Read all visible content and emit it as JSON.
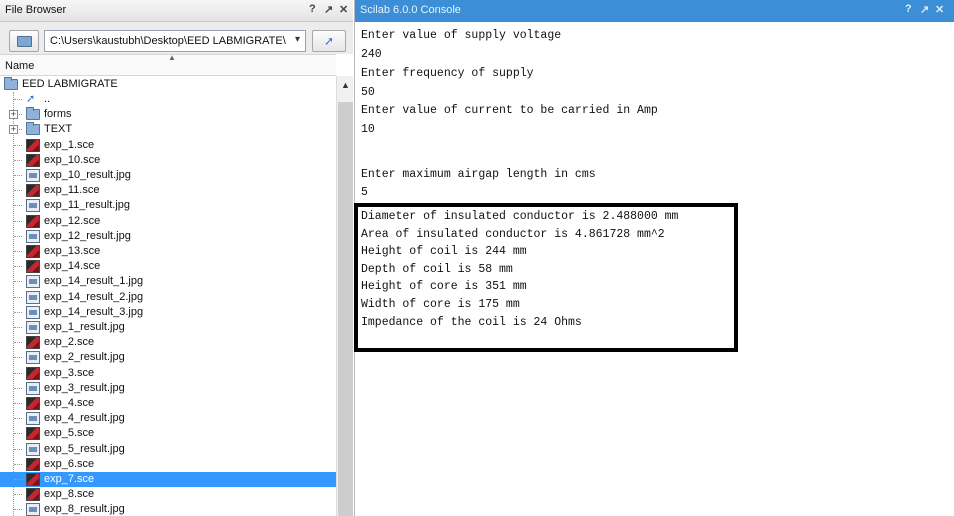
{
  "file_browser": {
    "title": "File Browser",
    "controls": [
      "?",
      "↗",
      "✕"
    ],
    "path": "C:\\Users\\kaustubh\\Desktop\\EED LABMIGRATE\\",
    "column_header": "Name",
    "root": "EED LABMIGRATE",
    "items": [
      {
        "label": "..",
        "kind": "up"
      },
      {
        "label": "forms",
        "kind": "folder"
      },
      {
        "label": "TEXT",
        "kind": "folder"
      },
      {
        "label": "exp_1.sce",
        "kind": "sce"
      },
      {
        "label": "exp_10.sce",
        "kind": "sce"
      },
      {
        "label": "exp_10_result.jpg",
        "kind": "jpg"
      },
      {
        "label": "exp_11.sce",
        "kind": "sce"
      },
      {
        "label": "exp_11_result.jpg",
        "kind": "jpg"
      },
      {
        "label": "exp_12.sce",
        "kind": "sce"
      },
      {
        "label": "exp_12_result.jpg",
        "kind": "jpg"
      },
      {
        "label": "exp_13.sce",
        "kind": "sce"
      },
      {
        "label": "exp_14.sce",
        "kind": "sce"
      },
      {
        "label": "exp_14_result_1.jpg",
        "kind": "jpg"
      },
      {
        "label": "exp_14_result_2.jpg",
        "kind": "jpg"
      },
      {
        "label": "exp_14_result_3.jpg",
        "kind": "jpg"
      },
      {
        "label": "exp_1_result.jpg",
        "kind": "jpg"
      },
      {
        "label": "exp_2.sce",
        "kind": "sce"
      },
      {
        "label": "exp_2_result.jpg",
        "kind": "jpg"
      },
      {
        "label": "exp_3.sce",
        "kind": "sce"
      },
      {
        "label": "exp_3_result.jpg",
        "kind": "jpg"
      },
      {
        "label": "exp_4.sce",
        "kind": "sce"
      },
      {
        "label": "exp_4_result.jpg",
        "kind": "jpg"
      },
      {
        "label": "exp_5.sce",
        "kind": "sce"
      },
      {
        "label": "exp_5_result.jpg",
        "kind": "jpg"
      },
      {
        "label": "exp_6.sce",
        "kind": "sce"
      },
      {
        "label": "exp_7.sce",
        "kind": "sce",
        "selected": true
      },
      {
        "label": "exp_8.sce",
        "kind": "sce"
      },
      {
        "label": "exp_8_result.jpg",
        "kind": "jpg"
      }
    ]
  },
  "console": {
    "title": "Scilab 6.0.0 Console",
    "controls": [
      "?",
      "↗",
      "✕"
    ],
    "lines": [
      "Enter value of supply voltage",
      "240",
      "Enter frequency of supply",
      "50",
      "Enter value of current to be carried in Amp",
      "10",
      "",
      "Enter maximum airgap length in cms",
      "5",
      "",
      "Diameter of insulated conductor is 2.488000 mm",
      "Area of insulated conductor is 4.861728 mm^2",
      "Height of coil is 244 mm",
      "Depth of coil is 58 mm",
      "Height of core is 351 mm",
      "Width of core is 175 mm",
      "Impedance of the coil is 24 Ohms"
    ]
  },
  "colors": {
    "console_title_bg": "#3c8fd6",
    "selection": "#3399ff"
  }
}
